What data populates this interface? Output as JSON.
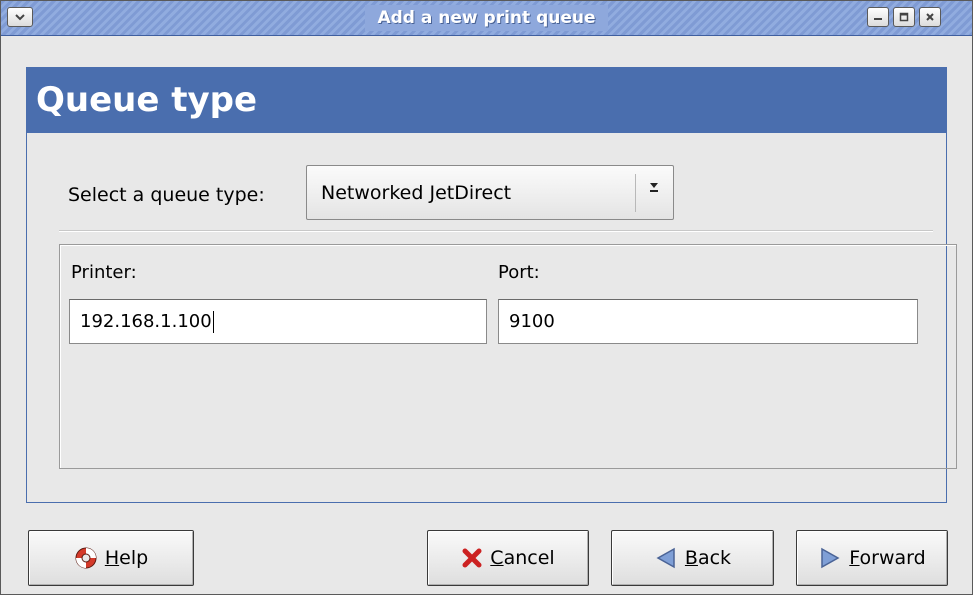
{
  "window": {
    "title": "Add a new print queue"
  },
  "header": {
    "title": "Queue type"
  },
  "queue_type": {
    "label": "Select a queue type:",
    "selected_value": "Networked JetDirect"
  },
  "fields": {
    "printer_label": "Printer:",
    "printer_value": "192.168.1.100",
    "port_label": "Port:",
    "port_value": "9100"
  },
  "buttons": {
    "help": "Help",
    "cancel": "Cancel",
    "back": "Back",
    "forward": "Forward"
  },
  "icons": {
    "window_menu": "chevron-down-icon",
    "minimize": "minimize-icon",
    "maximize": "maximize-icon",
    "close": "close-icon",
    "help": "lifebuoy-icon",
    "cancel": "red-x-icon",
    "back": "left-triangle-icon",
    "forward": "right-triangle-icon"
  },
  "colors": {
    "title_bar": "#8ea8dc",
    "header_band": "#4a6eae",
    "cancel_icon": "#cc2222",
    "nav_arrow": "#7f9fd6"
  }
}
